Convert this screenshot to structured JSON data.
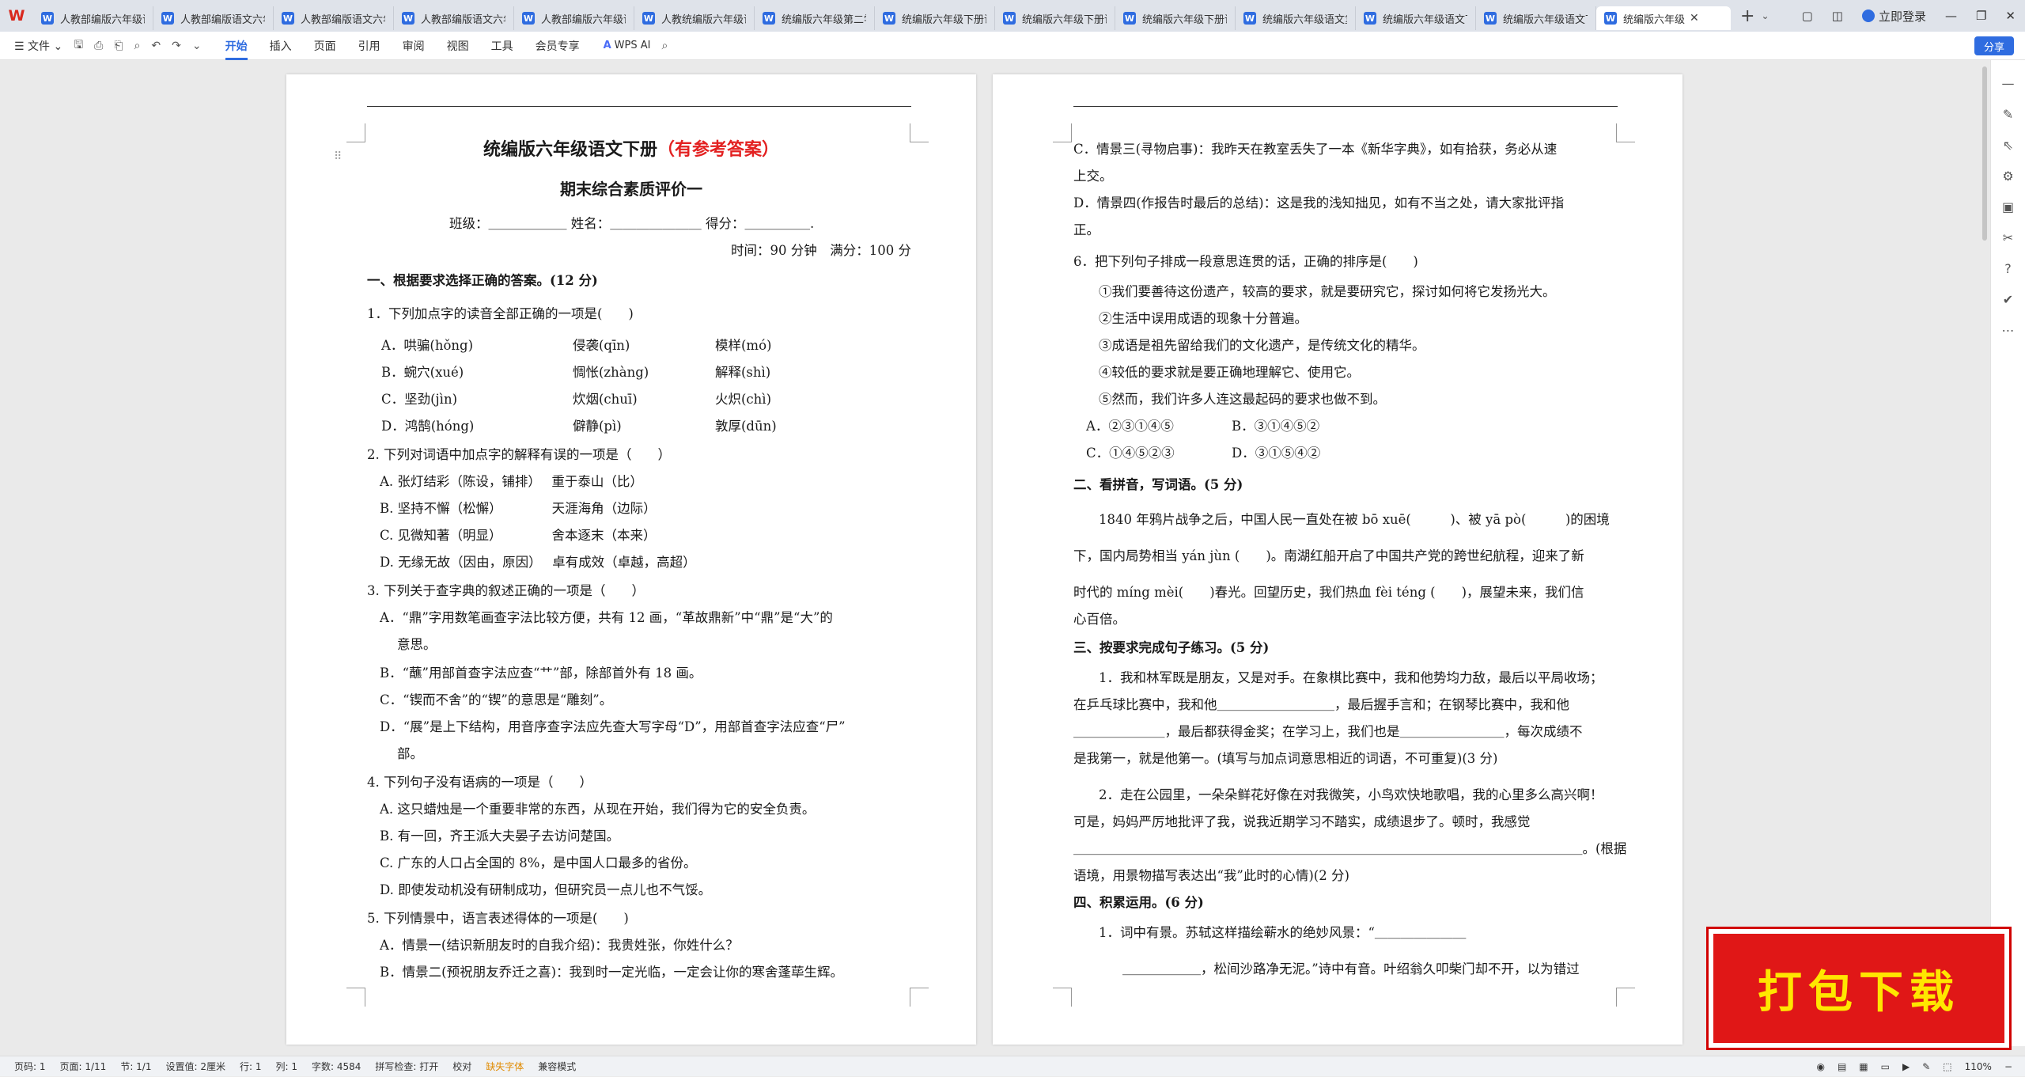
{
  "app": {
    "name": "WPS Office",
    "logo": "W"
  },
  "tabs": [
    {
      "label": "人教部编版六年级语"
    },
    {
      "label": "人教部编版语文六年"
    },
    {
      "label": "人教部编版语文六年"
    },
    {
      "label": "人教部编版语文六年"
    },
    {
      "label": "人教部编版六年级语"
    },
    {
      "label": "人教统编版六年级语"
    },
    {
      "label": "统编版六年级第二学"
    },
    {
      "label": "统编版六年级下册语"
    },
    {
      "label": "统编版六年级下册语"
    },
    {
      "label": "统编版六年级下册语"
    },
    {
      "label": "统编版六年级语文复"
    },
    {
      "label": "统编版六年级语文下"
    },
    {
      "label": "统编版六年级语文下"
    },
    {
      "label": "统编版六年级"
    }
  ],
  "window": {
    "login": "立即登录"
  },
  "toolbar": {
    "file": "文件",
    "menus": [
      "开始",
      "插入",
      "页面",
      "引用",
      "审阅",
      "视图",
      "工具",
      "会员专享"
    ],
    "active": "开始",
    "ai": "WPS AI",
    "share": "分享"
  },
  "page1": {
    "title_black": "统编版六年级语文下册",
    "title_red": "（有参考答案）",
    "subtitle": "期末综合素质评价一",
    "info": "班级：＿＿＿＿＿＿ 姓名：＿＿＿＿＿＿＿ 得分：＿＿＿＿＿.",
    "time": "时间：90 分钟　满分：100 分",
    "lines": [
      "一、根据要求选择正确的答案。(12 分)",
      "1．下列加点字的读音全部正确的一项是(　　)",
      "2. 下列对词语中加点字的解释有误的一项是（　　）",
      "A. 张灯结彩（陈设，铺排）　 重于泰山（比）",
      "B. 坚持不懈（松懈）　　　　 天涯海角（边际）",
      "C. 见微知著（明显）　　　　 舍本逐末（本来）",
      "D. 无缘无故（因由，原因）　 卓有成效（卓越，高超）",
      "3. 下列关于查字典的叙述正确的一项是（　　）",
      "A．“鼎”字用数笔画查字法比较方便，共有 12 画，“革故鼎新”中“鼎”是“大”的",
      "意思。",
      "B．“蘸”用部首查字法应查“艹”部，除部首外有 18 画。",
      "C．“锲而不舍”的“锲”的意思是“雕刻”。",
      "D．“展”是上下结构，用音序查字法应先查大写字母“D”，用部首查字法应查“尸”",
      "部。",
      "4. 下列句子没有语病的一项是（　　）",
      "A. 这只蜡烛是一个重要非常的东西，从现在开始，我们得为它的安全负责。",
      "B. 有一回，齐王派大夫晏子去访问楚国。",
      "C. 广东的人口占全国的 8%，是中国人口最多的省份。",
      "D. 即使发动机没有研制成功，但研究员一点儿也不气馁。",
      "5. 下列情景中，语言表述得体的一项是(　　)",
      "A．情景一(结识新朋友时的自我介绍)：我贵姓张，你姓什么？",
      "B．情景二(预祝朋友乔迁之喜)：我到时一定光临，一定会让你的寒舍蓬荜生辉。"
    ],
    "q1_rows": [
      [
        "A．哄骗(hǒng)",
        "侵袭(qīn)",
        "模样(mó)"
      ],
      [
        "B．蜿穴(xué)",
        "惆怅(zhàng)",
        "解释(shì)"
      ],
      [
        "C．坚劲(jìn)",
        "炊烟(chuī)",
        "火炽(chì)"
      ],
      [
        "D．鸿鹄(hóng)",
        "僻静(pì)",
        "敦厚(dūn)"
      ]
    ]
  },
  "page2": {
    "lines": [
      "C．情景三(寻物启事)：我昨天在教室丢失了一本《新华字典》，如有拾获，务必从速",
      "上交。",
      "D．情景四(作报告时最后的总结)：这是我的浅知拙见，如有不当之处，请大家批评指",
      "正。",
      "6．把下列句子排成一段意思连贯的话，正确的排序是(　　)",
      "①我们要善待这份遗产，较高的要求，就是要研究它，探讨如何将它发扬光大。",
      "②生活中误用成语的现象十分普遍。",
      "③成语是祖先留给我们的文化遗产，是传统文化的精华。",
      "④较低的要求就是要正确地理解它、使用它。",
      "⑤然而，我们许多人连这最起码的要求也做不到。",
      "二、看拼音，写词语。(5 分)",
      "1840 年鸦片战争之后，中国人民一直处在被 bō xuē(　　　)、被 yā pò(　　　)的困境",
      "下，国内局势相当 yán jùn (　　)。南湖红船开启了中国共产党的跨世纪航程，迎来了新",
      "时代的 míng mèi(　　)春光。回望历史，我们热血 fèi téng (　　)，展望未来，我们信",
      "心百倍。",
      "三、按要求完成句子练习。(5 分)",
      "1．我和林军既是朋友，又是对手。在象棋比赛中，我和他势均力敌，最后以平局收场；",
      "在乒乓球比赛中，我和他＿＿＿＿＿＿＿＿＿，最后握手言和；在钢琴比赛中，我和他",
      "＿＿＿＿＿＿＿，最后都获得金奖；在学习上，我们也是＿＿＿＿＿＿＿＿，每次成绩不",
      "是我第一，就是他第一。(填写与加点词意思相近的词语，不可重复)(3 分)",
      "2．走在公园里，一朵朵鲜花好像在对我微笑，小鸟欢快地歌唱，我的心里多么高兴啊！",
      "可是，妈妈严厉地批评了我，说我近期学习不踏实，成绩退步了。顿时，我感觉",
      "＿＿＿＿＿＿＿＿＿＿＿＿＿＿＿＿＿＿＿＿＿＿＿＿＿＿＿＿＿＿＿＿＿＿＿＿＿＿＿。(根据",
      "语境，用景物描写表达出“我”此时的心情)(2 分)",
      "四、积累运用。(6 分)",
      "1．词中有景。苏轼这样描绘蕲水的绝妙风景：“＿＿＿＿＿＿＿",
      "＿＿＿＿＿＿，松间沙路净无泥。”诗中有音。叶绍翁久叩柴门却不开，以为错过"
    ],
    "q6_opts": [
      [
        "A．②③①④⑤",
        "B．③①④⑤②"
      ],
      [
        "C．①④⑤②③",
        "D．③①⑤④②"
      ]
    ]
  },
  "status": {
    "page": "页码: 1",
    "pages": "页面: 1/11",
    "section": "节: 1/1",
    "setting": "设置值: 2厘米",
    "row": "行: 1",
    "col": "列: 1",
    "words": "字数: 4584",
    "spell": "拼写检查: 打开",
    "proof": "校对",
    "font": "缺失字体",
    "compat": "兼容模式",
    "zoom": "110%"
  },
  "banner": {
    "text": "打包下载"
  }
}
